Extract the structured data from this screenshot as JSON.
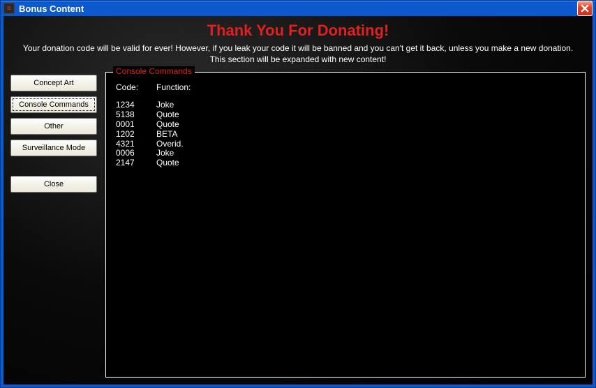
{
  "window": {
    "title": "Bonus Content"
  },
  "header": {
    "heading": "Thank You For Donating!",
    "line1": "Your donation code will be valid for ever! However, if you leak your code it will be banned and you can't get it back, unless you make a new donation.",
    "line2": "This section will be expanded with new content!"
  },
  "sidebar": {
    "items": [
      {
        "label": "Concept Art"
      },
      {
        "label": "Console Commands",
        "selected": true
      },
      {
        "label": "Other"
      },
      {
        "label": "Surveillance Mode"
      }
    ],
    "close_label": "Close"
  },
  "panel": {
    "legend": "Console Commands",
    "columns": {
      "code": "Code:",
      "function": "Function:"
    },
    "rows": [
      {
        "code": "1234",
        "function": "Joke"
      },
      {
        "code": "5138",
        "function": "Quote"
      },
      {
        "code": "0001",
        "function": "Quote"
      },
      {
        "code": "1202",
        "function": "BETA"
      },
      {
        "code": "4321",
        "function": "Overid."
      },
      {
        "code": "0006",
        "function": "Joke"
      },
      {
        "code": "2147",
        "function": "Quote"
      }
    ]
  }
}
